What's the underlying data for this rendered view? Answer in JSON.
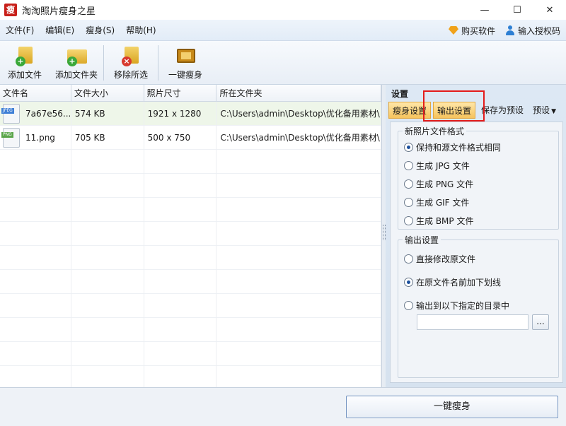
{
  "window": {
    "logo_text": "瘦",
    "title": "淘淘照片瘦身之星",
    "controls": [
      "—",
      "☐",
      "✕"
    ]
  },
  "menu": {
    "items": [
      "文件(F)",
      "编辑(E)",
      "瘦身(S)",
      "帮助(H)"
    ],
    "buy": "购买软件",
    "license": "输入授权码"
  },
  "toolbar": {
    "add_file": "添加文件",
    "add_folder": "添加文件夹",
    "remove_selected": "移除所选",
    "one_click_slim": "一键瘦身"
  },
  "table": {
    "columns": [
      "文件名",
      "文件大小",
      "照片尺寸",
      "所在文件夹"
    ],
    "rows": [
      {
        "icon": "JPEG",
        "name": "7a67e56...",
        "size": "574 KB",
        "dimensions": "1921 x 1280",
        "folder": "C:\\Users\\admin\\Desktop\\优化备用素材\\"
      },
      {
        "icon": "PNG",
        "name": "11.png",
        "size": "705 KB",
        "dimensions": "500 x 750",
        "folder": "C:\\Users\\admin\\Desktop\\优化备用素材\\"
      }
    ]
  },
  "settings": {
    "title": "设置",
    "tabs": [
      "瘦身设置",
      "输出设置",
      "保存为预设",
      "预设"
    ],
    "format_group": {
      "title": "新照片文件格式",
      "options": [
        "保持和源文件格式相同",
        "生成 JPG 文件",
        "生成 PNG 文件",
        "生成 GIF 文件",
        "生成 BMP 文件"
      ],
      "selected": 0
    },
    "output_group": {
      "title": "输出设置",
      "options": [
        "直接修改原文件",
        "在原文件名前加下划线",
        "输出到以下指定的目录中"
      ],
      "selected": 1,
      "path_value": "",
      "browse_label": "..."
    }
  },
  "bottom": {
    "slim_button": "一键瘦身"
  }
}
